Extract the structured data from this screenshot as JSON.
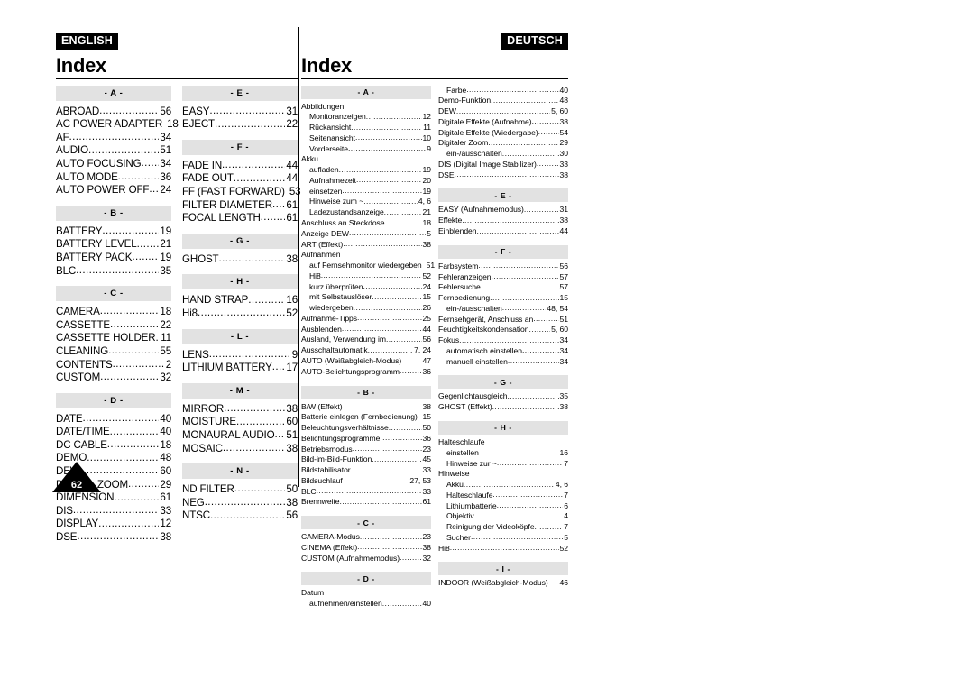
{
  "page_number": "62",
  "divider": "vertical-rule",
  "english": {
    "lang_tag": "ENGLISH",
    "title": "Index",
    "columns": [
      {
        "groups": [
          {
            "letter": "- A -",
            "entries": [
              {
                "label": "ABROAD",
                "page": "56"
              },
              {
                "label": "AC POWER ADAPTER",
                "page": "18",
                "dots": false
              },
              {
                "label": "AF",
                "page": "34"
              },
              {
                "label": "AUDIO",
                "page": "51"
              },
              {
                "label": "AUTO FOCUSING",
                "page": "34"
              },
              {
                "label": "AUTO MODE",
                "page": "36"
              },
              {
                "label": "AUTO POWER OFF",
                "page": "24"
              }
            ]
          },
          {
            "letter": "- B -",
            "entries": [
              {
                "label": "BATTERY",
                "page": "19"
              },
              {
                "label": "BATTERY LEVEL",
                "page": "21"
              },
              {
                "label": "BATTERY PACK",
                "page": "19"
              },
              {
                "label": "BLC",
                "page": "35"
              }
            ]
          },
          {
            "letter": "- C -",
            "entries": [
              {
                "label": "CAMERA",
                "page": "18"
              },
              {
                "label": "CASSETTE",
                "page": "22"
              },
              {
                "label": "CASSETTE HOLDER",
                "page": "11"
              },
              {
                "label": "CLEANING",
                "page": "55"
              },
              {
                "label": "CONTENTS",
                "page": "2"
              },
              {
                "label": "CUSTOM",
                "page": "32"
              }
            ]
          },
          {
            "letter": "- D -",
            "entries": [
              {
                "label": "DATE",
                "page": "40"
              },
              {
                "label": "DATE/TIME",
                "page": "40"
              },
              {
                "label": "DC CABLE",
                "page": "18"
              },
              {
                "label": "DEMO",
                "page": "48"
              },
              {
                "label": "DEW",
                "page": "60"
              },
              {
                "label": "DIGITAL ZOOM",
                "page": "29"
              },
              {
                "label": "DIMENSION",
                "page": "61"
              },
              {
                "label": "DIS",
                "page": "33"
              },
              {
                "label": "DISPLAY",
                "page": "12"
              },
              {
                "label": "DSE",
                "page": "38"
              }
            ]
          }
        ]
      },
      {
        "groups": [
          {
            "letter": "- E -",
            "entries": [
              {
                "label": "EASY",
                "page": "31"
              },
              {
                "label": "EJECT",
                "page": "22"
              }
            ]
          },
          {
            "letter": "- F -",
            "entries": [
              {
                "label": "FADE IN",
                "page": "44"
              },
              {
                "label": "FADE OUT",
                "page": "44"
              },
              {
                "label": "FF (FAST FORWARD)",
                "page": "53",
                "dots": false
              },
              {
                "label": "FILTER DIAMETER",
                "page": "61"
              },
              {
                "label": "FOCAL LENGTH",
                "page": "61"
              }
            ]
          },
          {
            "letter": "- G -",
            "entries": [
              {
                "label": "GHOST",
                "page": "38"
              }
            ]
          },
          {
            "letter": "- H -",
            "entries": [
              {
                "label": "HAND STRAP",
                "page": "16"
              },
              {
                "label": "Hi8",
                "page": "52"
              }
            ]
          },
          {
            "letter": "- L -",
            "entries": [
              {
                "label": "LENS",
                "page": "9"
              },
              {
                "label": "LITHIUM BATTERY",
                "page": "17"
              }
            ]
          },
          {
            "letter": "- M -",
            "entries": [
              {
                "label": "MIRROR",
                "page": "38"
              },
              {
                "label": "MOISTURE",
                "page": "60"
              },
              {
                "label": "MONAURAL AUDIO",
                "page": "51"
              },
              {
                "label": "MOSAIC",
                "page": "38"
              }
            ]
          },
          {
            "letter": "- N -",
            "entries": [
              {
                "label": "ND FILTER",
                "page": "50"
              },
              {
                "label": "NEG",
                "page": "38"
              },
              {
                "label": "NTSC",
                "page": "56"
              }
            ]
          }
        ]
      }
    ]
  },
  "deutsch": {
    "lang_tag": "DEUTSCH",
    "title": "Index",
    "columns": [
      {
        "groups": [
          {
            "letter": "- A -",
            "entries": [
              {
                "label": "Abbildungen",
                "page": "",
                "dots": false
              },
              {
                "label": "Monitoranzeigen",
                "page": "12",
                "indent": 1
              },
              {
                "label": "Rückansicht",
                "page": "11",
                "indent": 1
              },
              {
                "label": "Seitenansicht",
                "page": "10",
                "indent": 1
              },
              {
                "label": "Vorderseite",
                "page": "9",
                "indent": 1
              },
              {
                "label": "Akku",
                "page": "",
                "dots": false
              },
              {
                "label": "aufladen",
                "page": "19",
                "indent": 1
              },
              {
                "label": "Aufnahmezeit",
                "page": "20",
                "indent": 1
              },
              {
                "label": "einsetzen",
                "page": "19",
                "indent": 1
              },
              {
                "label": "Hinweise zum ~",
                "page": "4, 6",
                "indent": 1
              },
              {
                "label": "Ladezustandsanzeige",
                "page": "21",
                "indent": 1
              },
              {
                "label": "Anschluss an Steckdose",
                "page": "18"
              },
              {
                "label": "Anzeige DEW",
                "page": "5"
              },
              {
                "label": "ART (Effekt)",
                "page": "38"
              },
              {
                "label": "Aufnahmen",
                "page": "",
                "dots": false
              },
              {
                "label": "auf Fernsehmonitor wiedergeben",
                "page": "51",
                "indent": 1,
                "dots": false
              },
              {
                "label": "Hi8",
                "page": "52",
                "indent": 1
              },
              {
                "label": "kurz überprüfen",
                "page": "24",
                "indent": 1
              },
              {
                "label": "mit Selbstauslöser",
                "page": "15",
                "indent": 1
              },
              {
                "label": "wiedergeben",
                "page": "26",
                "indent": 1
              },
              {
                "label": "Aufnahme-Tipps",
                "page": "25"
              },
              {
                "label": "Ausblenden",
                "page": "44"
              },
              {
                "label": "Ausland, Verwendung im",
                "page": "56"
              },
              {
                "label": "Ausschaltautomatik",
                "page": "7, 24"
              },
              {
                "label": "AUTO (Weißabgleich-Modus)",
                "page": "47"
              },
              {
                "label": "AUTO-Belichtungsprogramm",
                "page": "36"
              }
            ]
          },
          {
            "letter": "- B -",
            "entries": [
              {
                "label": "B/W (Effekt)",
                "page": "38"
              },
              {
                "label": "Batterie einlegen (Fernbedienung)",
                "page": "15",
                "dots": false
              },
              {
                "label": "Beleuchtungsverhältnisse",
                "page": "50"
              },
              {
                "label": "Belichtungsprogramme",
                "page": "36"
              },
              {
                "label": "Betriebsmodus",
                "page": "23"
              },
              {
                "label": "Bild-im-Bild-Funktion",
                "page": "45"
              },
              {
                "label": "Bildstabilisator",
                "page": "33"
              },
              {
                "label": "Bildsuchlauf",
                "page": "27, 53"
              },
              {
                "label": "BLC",
                "page": "33"
              },
              {
                "label": "Brennweite",
                "page": "61"
              }
            ]
          },
          {
            "letter": "- C -",
            "entries": [
              {
                "label": "CAMERA-Modus",
                "page": "23"
              },
              {
                "label": "CINEMA (Effekt)",
                "page": "38"
              },
              {
                "label": "CUSTOM (Aufnahmemodus)",
                "page": "32"
              }
            ]
          },
          {
            "letter": "- D -",
            "entries": [
              {
                "label": "Datum",
                "page": "",
                "dots": false
              },
              {
                "label": "aufnehmen/einstellen",
                "page": "40",
                "indent": 1
              }
            ]
          }
        ]
      },
      {
        "groups": [
          {
            "letter": "",
            "entries": [
              {
                "label": "Farbe",
                "page": "40",
                "indent": 1
              },
              {
                "label": "Demo-Funktion",
                "page": "48"
              },
              {
                "label": "DEW",
                "page": "5, 60"
              },
              {
                "label": "Digitale Effekte (Aufnahme)",
                "page": "38"
              },
              {
                "label": "Digitale Effekte (Wiedergabe)",
                "page": "54"
              },
              {
                "label": "Digitaler Zoom",
                "page": "29"
              },
              {
                "label": "ein-/ausschalten",
                "page": "30",
                "indent": 1
              },
              {
                "label": "DIS (Digital Image Stabilizer)",
                "page": "33"
              },
              {
                "label": "DSE",
                "page": "38"
              }
            ]
          },
          {
            "letter": "- E -",
            "entries": [
              {
                "label": "EASY (Aufnahmemodus)",
                "page": "31"
              },
              {
                "label": "Effekte",
                "page": "38"
              },
              {
                "label": "Einblenden",
                "page": "44"
              }
            ]
          },
          {
            "letter": "- F -",
            "entries": [
              {
                "label": "Farbsystem",
                "page": "56"
              },
              {
                "label": "Fehleranzeigen",
                "page": "57"
              },
              {
                "label": "Fehlersuche",
                "page": "57"
              },
              {
                "label": "Fernbedienung",
                "page": "15"
              },
              {
                "label": "ein-/ausschalten",
                "page": "48, 54",
                "indent": 1
              },
              {
                "label": "Fernsehgerät, Anschluss an",
                "page": "51"
              },
              {
                "label": "Feuchtigkeitskondensation",
                "page": "5, 60"
              },
              {
                "label": "Fokus",
                "page": "34"
              },
              {
                "label": "automatisch einstellen",
                "page": "34",
                "indent": 1
              },
              {
                "label": "manuell einstellen",
                "page": "34",
                "indent": 1
              }
            ]
          },
          {
            "letter": "- G -",
            "entries": [
              {
                "label": "Gegenlichtausgleich",
                "page": "35"
              },
              {
                "label": "GHOST (Effekt)",
                "page": "38"
              }
            ]
          },
          {
            "letter": "- H -",
            "entries": [
              {
                "label": "Halteschlaufe",
                "page": "",
                "dots": false
              },
              {
                "label": "einstellen",
                "page": "16",
                "indent": 1
              },
              {
                "label": "Hinweise zur ~",
                "page": "7",
                "indent": 1
              },
              {
                "label": "Hinweise",
                "page": "",
                "dots": false
              },
              {
                "label": "Akku",
                "page": "4, 6",
                "indent": 1
              },
              {
                "label": "Halteschlaufe",
                "page": "7",
                "indent": 1
              },
              {
                "label": "Lithiumbatterie",
                "page": "6",
                "indent": 1
              },
              {
                "label": "Objektiv",
                "page": "4",
                "indent": 1
              },
              {
                "label": "Reinigung der Videoköpfe",
                "page": "7",
                "indent": 1
              },
              {
                "label": "Sucher",
                "page": "5",
                "indent": 1
              },
              {
                "label": "Hi8",
                "page": "52"
              }
            ]
          },
          {
            "letter": "- I -",
            "entries": [
              {
                "label": "INDOOR (Weißabgleich-Modus)",
                "page": "46",
                "dots": false
              }
            ]
          }
        ]
      }
    ]
  }
}
